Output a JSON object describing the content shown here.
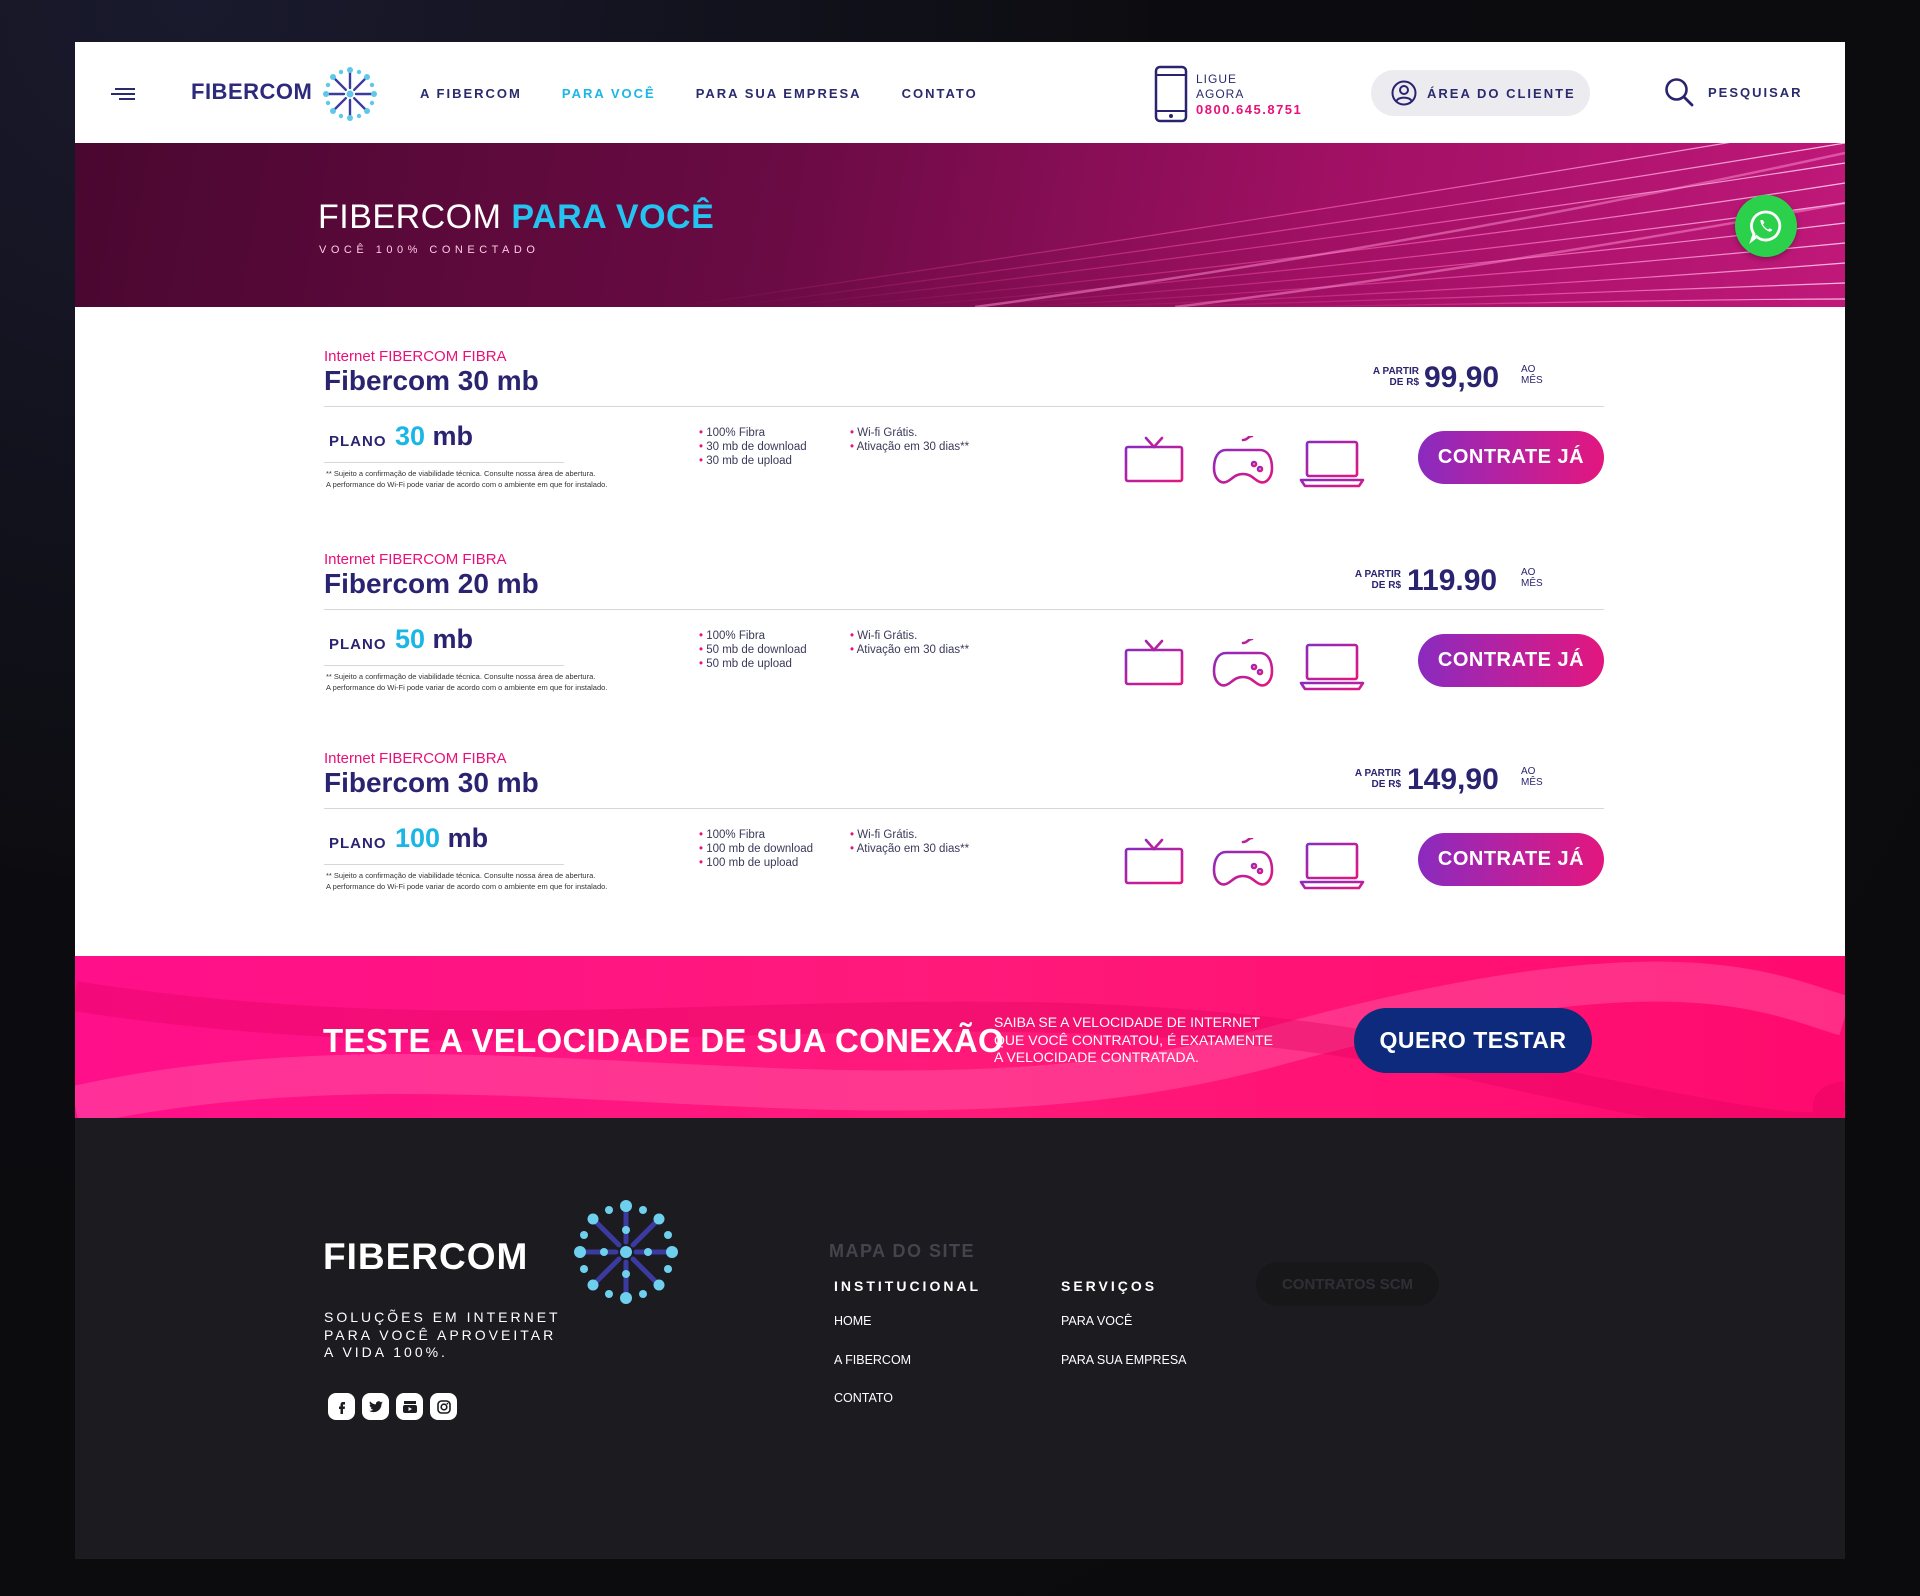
{
  "header": {
    "logo": "FIBERCOM",
    "nav": [
      "A FIBERCOM",
      "PARA VOCÊ",
      "PARA SUA EMPRESA",
      "CONTATO"
    ],
    "active_nav": "PARA VOCÊ",
    "phone_line1": "LIGUE",
    "phone_line2": "AGORA",
    "phone_number": "0800.645.8751",
    "client_area": "ÁREA DO CLIENTE",
    "search": "PESQUISAR"
  },
  "hero": {
    "title_a": "FIBERCOM ",
    "title_b": "PARA VOCÊ",
    "subtitle": "VOCÊ 100% CONECTADO"
  },
  "plans": [
    {
      "kicker": "Internet FIBERCOM FIBRA",
      "name": "Fibercom 30 mb",
      "price_prefix_1": "A PARTIR",
      "price_prefix_2": "DE R$",
      "price": "99,90",
      "price_suffix_1": "AO",
      "price_suffix_2": "MÊS",
      "plano_label": "PLANO",
      "plano_number": "30",
      "plano_unit": " mb",
      "disclaimer_1": "** Sujeito a confirmação de viabilidade técnica. Consulte nossa área de abertura.",
      "disclaimer_2": "A performance do Wi-Fi pode variar de acordo com o ambiente em que for instalado.",
      "features_a": [
        "100% Fibra",
        "30 mb de download",
        "30 mb de upload"
      ],
      "features_b": [
        "Wi-fi Grátis.",
        "Ativação em 30 dias**"
      ],
      "cta": "CONTRATE JÁ"
    },
    {
      "kicker": "Internet FIBERCOM FIBRA",
      "name": "Fibercom 20 mb",
      "price_prefix_1": "A PARTIR",
      "price_prefix_2": "DE R$",
      "price": "119.90",
      "price_suffix_1": "AO",
      "price_suffix_2": "MÊS",
      "plano_label": "PLANO",
      "plano_number": "50",
      "plano_unit": " mb",
      "disclaimer_1": "** Sujeito a confirmação de viabilidade técnica. Consulte nossa área de abertura.",
      "disclaimer_2": "A performance do Wi-Fi pode variar de acordo com o ambiente em que for instalado.",
      "features_a": [
        "100% Fibra",
        "50 mb de download",
        "50 mb de upload"
      ],
      "features_b": [
        "Wi-fi Grátis.",
        "Ativação em 30 dias**"
      ],
      "cta": "CONTRATE JÁ"
    },
    {
      "kicker": "Internet FIBERCOM FIBRA",
      "name": "Fibercom 30 mb",
      "price_prefix_1": "A PARTIR",
      "price_prefix_2": "DE R$",
      "price": "149,90",
      "price_suffix_1": "AO",
      "price_suffix_2": "MÊS",
      "plano_label": "PLANO",
      "plano_number": "100",
      "plano_unit": " mb",
      "disclaimer_1": "** Sujeito a confirmação de viabilidade técnica. Consulte nossa área de abertura.",
      "disclaimer_2": "A performance do Wi-Fi pode variar de acordo com o ambiente em que for instalado.",
      "features_a": [
        "100% Fibra",
        "100 mb de download",
        "100 mb de upload"
      ],
      "features_b": [
        "Wi-fi Grátis.",
        "Ativação em 30 dias**"
      ],
      "cta": "CONTRATE JÁ"
    }
  ],
  "speed": {
    "title": "TESTE A VELOCIDADE DE SUA CONEXÃO",
    "text_1": "SAIBA SE A VELOCIDADE DE INTERNET",
    "text_2": "QUE VOCÊ CONTRATOU, É EXATAMENTE",
    "text_3": "A VELOCIDADE CONTRATADA.",
    "button": "QUERO TESTAR"
  },
  "footer": {
    "logo": "FIBERCOM",
    "slogan_1": "SOLUÇÕES EM INTERNET",
    "slogan_2": "PARA VOCÊ APROVEITAR",
    "slogan_3": "A VIDA 100%.",
    "sitemap_title": "MAPA DO SITE",
    "col1_title": "INSTITUCIONAL",
    "col1_links": [
      "HOME",
      "A FIBERCOM",
      "CONTATO"
    ],
    "col2_title": "SERVIÇOS",
    "col2_links": [
      "PARA VOCÊ",
      "PARA SUA EMPRESA"
    ],
    "contracts": "CONTRATOS SCM",
    "social_icons": [
      "facebook-icon",
      "twitter-icon",
      "youtube-icon",
      "instagram-icon"
    ]
  },
  "colors": {
    "brand_navy": "#2a2470",
    "brand_cyan": "#19b6e6",
    "brand_pink": "#e8107a",
    "whatsapp_green": "#2bd14a"
  }
}
